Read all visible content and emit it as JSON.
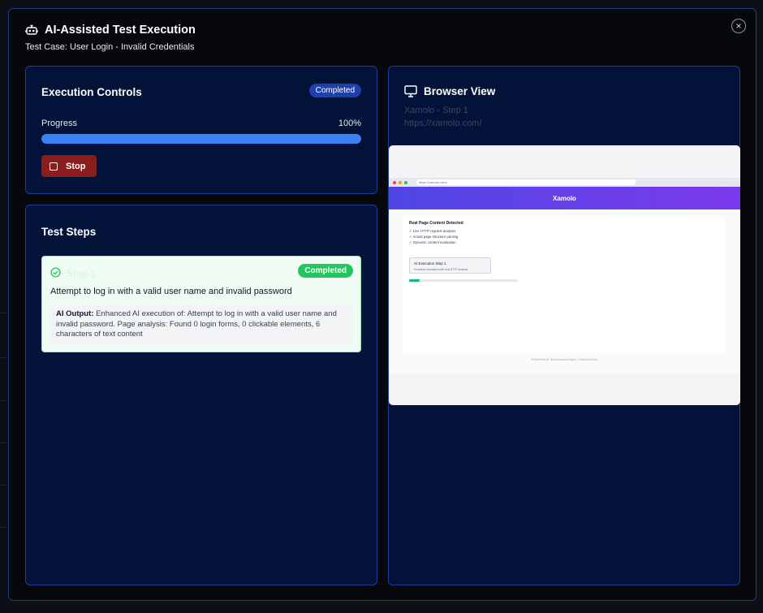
{
  "modal": {
    "title": "AI-Assisted Test Execution",
    "subtitle": "Test Case: User Login - Invalid Credentials",
    "close_label": "×"
  },
  "controls": {
    "title": "Execution Controls",
    "status": "Completed",
    "progress_label": "Progress",
    "progress_text": "100%",
    "progress_value": 100,
    "stop_label": "Stop"
  },
  "steps": {
    "title": "Test Steps",
    "items": [
      {
        "name": "Step 1",
        "status": "Completed",
        "description": "Attempt to log in with a valid user name and invalid password",
        "output_label": "AI Output:",
        "output_text": "Enhanced AI execution of: Attempt to log in with a valid user name and invalid password. Page analysis: Found 0 login forms, 0 clickable elements, 6 characters of text content"
      }
    ]
  },
  "browser": {
    "title": "Browser View",
    "page_title": "Xamolo - Step 1",
    "url": "https://xamolo.com/",
    "preview": {
      "address": "https://xamolo.com/",
      "site_name": "Xamolo",
      "heading": "Real Page Content Detected",
      "features": [
        "✓ Live HTTP request analysis",
        "✓ Actual page structure parsing",
        "✓ Dynamic content evaluation"
      ],
      "box_title": "AI Execution Step 1",
      "box_subtitle": "Enhanced simulation with real HTTP analysis",
      "progress_value": 10,
      "footer": "©OtherPass AI Test Execution Engine - Enhanced Mode"
    }
  },
  "colors": {
    "accent": "#3b82f6",
    "success": "#22c55e",
    "danger": "#8b1d1d",
    "panel": "#031239"
  }
}
